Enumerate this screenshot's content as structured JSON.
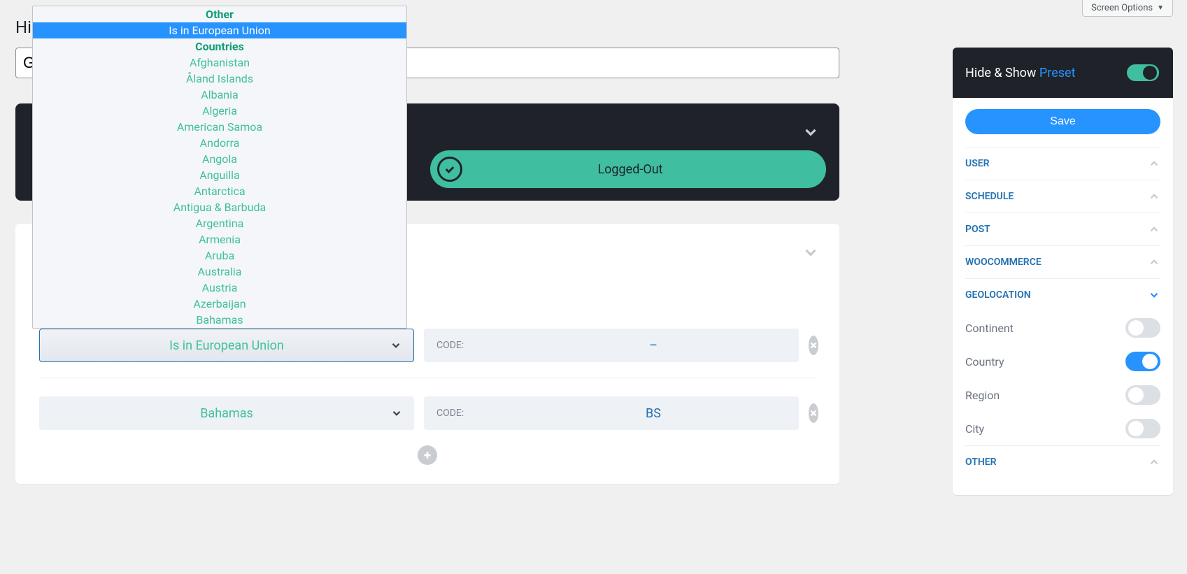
{
  "screen_options": "Screen Options",
  "page_title_prefix": "Hi",
  "title_value": "G",
  "logged_out_label": "Logged-Out",
  "rows": [
    {
      "select": "Is in European Union",
      "code_label": "CODE:",
      "code_value": "–",
      "active": true
    },
    {
      "select": "Bahamas",
      "code_label": "CODE:",
      "code_value": "BS",
      "active": false
    }
  ],
  "dropdown": {
    "group1": "Other",
    "selected": "Is in European Union",
    "group2": "Countries",
    "countries": [
      "Afghanistan",
      "Åland Islands",
      "Albania",
      "Algeria",
      "American Samoa",
      "Andorra",
      "Angola",
      "Anguilla",
      "Antarctica",
      "Antigua & Barbuda",
      "Argentina",
      "Armenia",
      "Aruba",
      "Australia",
      "Austria",
      "Azerbaijan",
      "Bahamas"
    ]
  },
  "sidebar": {
    "title_main": "Hide & Show ",
    "title_accent": "Preset",
    "save": "Save",
    "sections": {
      "user": "USER",
      "schedule": "SCHEDULE",
      "post": "POST",
      "woo": "WOOCOMMERCE",
      "geo": "GEOLOCATION",
      "other": "OTHER"
    },
    "geo_items": {
      "continent": "Continent",
      "country": "Country",
      "region": "Region",
      "city": "City"
    }
  }
}
